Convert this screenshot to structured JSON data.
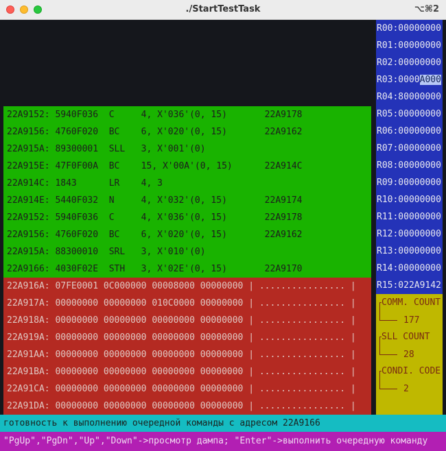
{
  "window": {
    "title": "./StartTestTask",
    "shortcut": "⌥⌘2"
  },
  "code_lines": [
    "22A9152: 5940F036  C     4, X'036'(0, 15)       22A9178",
    "22A9156: 4760F020  BC    6, X'020'(0, 15)       22A9162",
    "22A915A: 89300001  SLL   3, X'001'(0)",
    "22A915E: 47F0F00A  BC    15, X'00A'(0, 15)      22A914C",
    "22A914C: 1843      LR    4, 3",
    "22A914E: 5440F032  N     4, X'032'(0, 15)       22A9174",
    "22A9152: 5940F036  C     4, X'036'(0, 15)       22A9178",
    "22A9156: 4760F020  BC    6, X'020'(0, 15)       22A9162",
    "22A915A: 88300010  SRL   3, X'010'(0)",
    "22A9166: 4030F02E  STH   3, X'02E'(0, 15)       22A9170"
  ],
  "dump_lines": [
    "22A916A: 07FE0001 0C000000 00008000 00000000 | ................ |",
    "22A917A: 00000000 00000000 010C0000 00000000 | ................ |",
    "22A918A: 00000000 00000000 00000000 00000000 | ................ |",
    "22A919A: 00000000 00000000 00000000 00000000 | ................ |",
    "22A91AA: 00000000 00000000 00000000 00000000 | ................ |",
    "22A91BA: 00000000 00000000 00000000 00000000 | ................ |",
    "22A91CA: 00000000 00000000 00000000 00000000 | ................ |",
    "22A91DA: 00000000 00000000 00000000 00000000 | ................ |"
  ],
  "registers": [
    "R00:00000000",
    "R01:00000000",
    "R02:00000000",
    "R03:0000",
    "R04:80000000",
    "R05:00000000",
    "R06:00000000",
    "R07:00000000",
    "R08:00000000",
    "R09:00000000",
    "R10:00000000",
    "R11:00000000",
    "R12:00000000",
    "R13:00000000",
    "R14:00000000",
    "R15:022A9142"
  ],
  "r03_highlight": "A000",
  "counters": {
    "comm_label": "COMM. COUNT",
    "comm_value": "177",
    "sll_label": "SLL COUNT",
    "sll_value": "28",
    "cond_label": "CONDI. CODE",
    "cond_value": "2"
  },
  "status_text": "готовность к выполнению очередной команды с адресом 22A9166",
  "hint_text": "\"PgUp\",\"PgDn\",\"Up\",\"Down\"->просмотр дампа; \"Enter\"->выполнить очередную команду",
  "colors": {
    "code_bg": "#19b300",
    "dump_bg": "#b42a22",
    "regs_bg": "#2433b8",
    "counters_bg": "#bfb800",
    "status_bg": "#15bcc2",
    "hint_bg": "#b21fb3"
  }
}
